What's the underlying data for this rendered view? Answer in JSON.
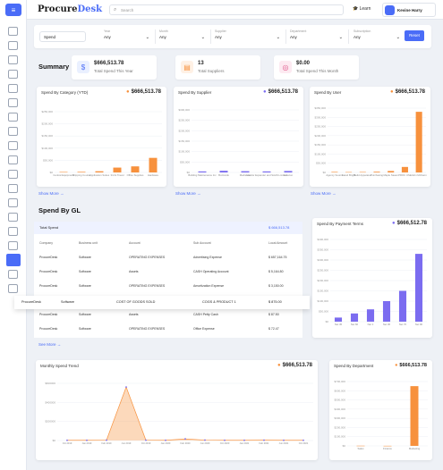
{
  "app": {
    "logo_a": "Procure",
    "logo_b": "Desk",
    "search_placeholder": "Search",
    "learn": "Learn",
    "user": "Kevine Harry"
  },
  "filters": {
    "spend_select": "Spend",
    "fields": [
      {
        "label": "Year",
        "value": "Any"
      },
      {
        "label": "Month",
        "value": "Any"
      },
      {
        "label": "Supplier",
        "value": "Any"
      },
      {
        "label": "Department",
        "value": "Any"
      },
      {
        "label": "Subscription",
        "value": "Any"
      }
    ],
    "reset": "Reset"
  },
  "summary": {
    "title": "Summary",
    "kpis": [
      {
        "value": "$666,513.78",
        "label": "Total Spend This Year",
        "color": "#4a6cf7",
        "bg": "#eaf0ff"
      },
      {
        "value": "13",
        "label": "Total Suppliers",
        "color": "#f7913d",
        "bg": "#fff1e5"
      },
      {
        "value": "$0.00",
        "label": "Total Spend This Month",
        "color": "#e0598b",
        "bg": "#fdeaf1"
      }
    ]
  },
  "cards": {
    "category": {
      "title": "Spend By Category (YTD)",
      "value": "$666,513.78"
    },
    "supplier": {
      "title": "Spend By Supplier",
      "value": "$666,513.78"
    },
    "user": {
      "title": "Spend By User",
      "value": "$666,513.78"
    },
    "payment": {
      "title": "Spend By Payment Terms",
      "value": "$666,512.78"
    },
    "monthly": {
      "title": "Monthly Spend Trend",
      "value": "$666,513.78"
    },
    "department": {
      "title": "Spend By Department",
      "value": "$666,513.78"
    }
  },
  "show_more": "Show More →",
  "see_more": "See More →",
  "gl": {
    "title": "Spend By GL",
    "total_label": "Total Spend",
    "total_value": "$ 666,513.78",
    "headers": [
      "Company",
      "Business unit",
      "Account",
      "Sub Account",
      "Local Amount"
    ],
    "rows": [
      [
        "ProcureDesk",
        "Software",
        "OPERATING EXPENSES",
        "Advertising Expense",
        "$ 657,164.75"
      ],
      [
        "ProcureDesk",
        "Software",
        "Assets",
        "CASH Operating Account",
        "$ 5,164.80"
      ],
      [
        "ProcureDesk",
        "Software",
        "OPERATING EXPENSES",
        "Amortization Expense",
        "$ 3,150.00"
      ],
      [
        "ProcureDesk",
        "Software",
        "Assets",
        "CASH Petty Cash",
        "$ 87.50"
      ],
      [
        "ProcureDesk",
        "Software",
        "OPERATING EXPENSES",
        "Office Expense",
        "$ 72.47"
      ]
    ],
    "highlight": [
      "ProcureDesk",
      "Software",
      "COST OF GOODS SOLD",
      "COGS & PRODUCT 1",
      "$ 875.00"
    ]
  },
  "chart_data": [
    {
      "type": "bar",
      "title": "Spend By Category (YTD)",
      "categories": [
        "Central Equipment",
        "Shipping Courier",
        "Application Suites",
        "3rd & Travel",
        "Office Supplies",
        "Hardware"
      ],
      "values": [
        2000,
        2500,
        5000,
        20000,
        25000,
        60000
      ],
      "yticks": [
        "$250,000",
        "$200,000",
        "$150,000",
        "$100,000",
        "$50,000",
        "$0"
      ],
      "ylim": [
        0,
        250000
      ],
      "color": "#f7913d"
    },
    {
      "type": "bar",
      "title": "Spend By Supplier",
      "categories": [
        "Building Maintenance Inc",
        "Buzzards",
        "Mediamar",
        "Vendor Expander and SAAS Limited",
        "Amazon"
      ],
      "values": [
        5000,
        8000,
        6000,
        5000,
        7000
      ],
      "yticks": [
        "$300,000",
        "$250,000",
        "$200,000",
        "$150,000",
        "$100,000",
        "$50,000",
        "$0"
      ],
      "ylim": [
        0,
        300000
      ],
      "color": "#7b6cf0"
    },
    {
      "type": "bar",
      "title": "Spend By User",
      "categories": [
        "Agency Source",
        "Stand Bright",
        "Build Apparatus",
        "Purchasing",
        "Maple Steam",
        "PROC USE",
        "John McKann"
      ],
      "values": [
        3000,
        2000,
        2500,
        4000,
        8000,
        30000,
        330000
      ],
      "yticks": [
        "$350,000",
        "$300,000",
        "$250,000",
        "$200,000",
        "$150,000",
        "$100,000",
        "$50,000",
        "$0"
      ],
      "ylim": [
        0,
        350000
      ],
      "color": "#f7913d"
    },
    {
      "type": "bar",
      "title": "Spend By Payment Terms",
      "categories": [
        "Net 45",
        "Net 60",
        "Net 1",
        "Net 30",
        "Net 70",
        "Net 90"
      ],
      "values": [
        20000,
        40000,
        60000,
        100000,
        150000,
        330000
      ],
      "yticks": [
        "$400,000",
        "$350,000",
        "$300,000",
        "$250,000",
        "$200,000",
        "$150,000",
        "$100,000",
        "$50,000",
        "$0"
      ],
      "ylim": [
        0,
        400000
      ],
      "color": "#7b6cf0"
    },
    {
      "type": "area",
      "title": "Monthly Spend Trend",
      "x": [
        "Oct 2019",
        "Jan 2019",
        "Feb 2019",
        "Jun 2019",
        "Oct 2019",
        "Jan 2020",
        "Feb 2020",
        "Jun 2020",
        "Oct 2020",
        "Jan 2021",
        "Feb 2021",
        "Jun 2021",
        "Oct 2021"
      ],
      "values": [
        3000,
        3000,
        4000,
        655000,
        4000,
        3000,
        20000,
        5000,
        3000,
        3000,
        4000,
        3000,
        3000
      ],
      "yticks": [
        "$600000",
        "$400000",
        "$200000",
        "$0"
      ],
      "ylim": [
        0,
        700000
      ],
      "color": "#f7913d"
    },
    {
      "type": "bar",
      "title": "Spend By Department",
      "categories": [
        "Sales",
        "Finance",
        "Marketing"
      ],
      "values": [
        2000,
        1000,
        650000
      ],
      "yticks": [
        "$700,000",
        "$600,000",
        "$500,000",
        "$400,000",
        "$300,000",
        "$200,000",
        "$100,000",
        "$0"
      ],
      "ylim": [
        0,
        700000
      ],
      "color": "#f7913d"
    }
  ]
}
